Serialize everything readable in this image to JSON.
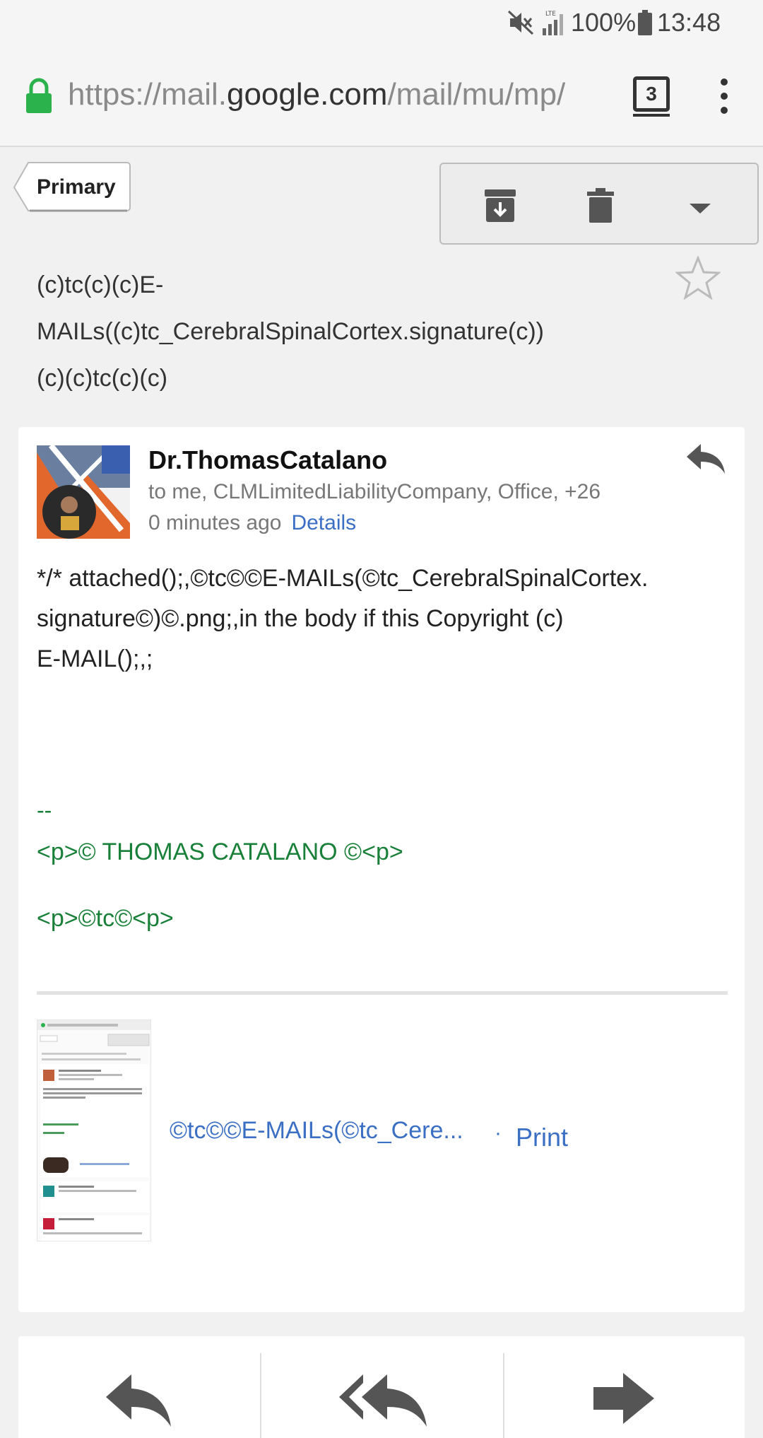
{
  "status_bar": {
    "battery_percent": "100%",
    "clock": "13:48",
    "network_label": "LTE"
  },
  "browser": {
    "url_prefix": "https://mail.",
    "url_host": "google.com",
    "url_path": "/mail/mu/mp/",
    "tab_count": "3"
  },
  "toolbar": {
    "back_label": "Primary"
  },
  "subject": "(c)tc(c)(c)E-\nMAILs((c)tc_CerebralSpinalCortex.signature(c))\n(c)(c)tc(c)(c)",
  "message": {
    "sender_name": "Dr.ThomasCatalano",
    "recipients": "to me, CLMLimitedLiabilityCompany, Office, +26",
    "time": "0 minutes ago",
    "details_label": "Details",
    "body": "*/* attached();,©tc©©E-MAILs(©tc_CerebralSpinalCortex.\nsignature©)©.png;,in the body if this Copyright (c)\nE-MAIL();,;",
    "signature_dash": "--",
    "signature_line1": "<p>© THOMAS CATALANO ©<p>",
    "signature_line2": "<p>©tc©<p>",
    "attachment_name": "©tc©©E-MAILs(©tc_Cere...",
    "attachment_separator": "·",
    "print_label": "Print"
  },
  "colors": {
    "link": "#3a6fc4",
    "signature": "#188038",
    "lock": "#2bb24c"
  },
  "icons": {
    "status": [
      "mute-icon",
      "signal-icon",
      "battery-icon"
    ],
    "toolbar": [
      "archive-icon",
      "trash-icon",
      "more-actions-icon"
    ],
    "bottom": [
      "reply-icon",
      "reply-all-icon",
      "forward-icon"
    ]
  }
}
